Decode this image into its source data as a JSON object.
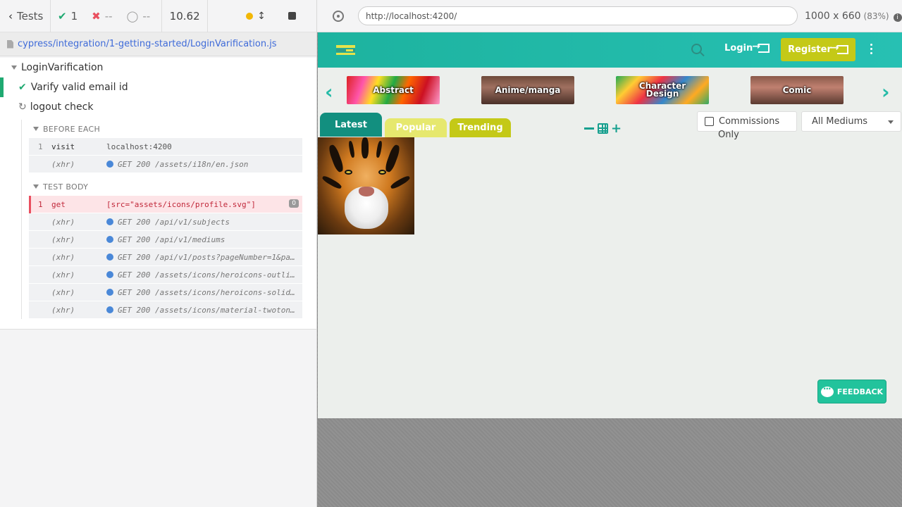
{
  "reporter": {
    "header": {
      "tests_label": "Tests",
      "passed_count": "1",
      "failed_count": "--",
      "pending_count": "--",
      "duration": "10.62"
    },
    "spec_path": "cypress/integration/1-getting-started/LoginVarification.js",
    "suite": {
      "title": "LoginVarification",
      "tests": [
        {
          "title": "Varify valid email id",
          "state": "passed"
        },
        {
          "title": "logout check",
          "state": "running"
        }
      ]
    },
    "before_each": {
      "title": "BEFORE EACH",
      "commands": [
        {
          "index": "1",
          "name": "visit",
          "message": "localhost:4200"
        },
        {
          "index": "",
          "name": "(xhr)",
          "message": "GET 200 /assets/i18n/en.json"
        }
      ]
    },
    "test_body": {
      "title": "TEST BODY",
      "failed_command": {
        "index": "1",
        "name": "get",
        "message": "[src=\"assets/icons/profile.svg\"]",
        "badge": "0"
      },
      "commands": [
        {
          "name": "(xhr)",
          "message": "GET 200 /api/v1/subjects"
        },
        {
          "name": "(xhr)",
          "message": "GET 200 /api/v1/mediums"
        },
        {
          "name": "(xhr)",
          "message": "GET 200 /api/v1/posts?pageNumber=1&pa…"
        },
        {
          "name": "(xhr)",
          "message": "GET 200 /assets/icons/heroicons-outli…"
        },
        {
          "name": "(xhr)",
          "message": "GET 200 /assets/icons/heroicons-solid…"
        },
        {
          "name": "(xhr)",
          "message": "GET 200 /assets/icons/material-twoton…"
        }
      ]
    }
  },
  "browser": {
    "url": "http://localhost:4200/",
    "viewport": "1000 x 660",
    "scale": "(83%)"
  },
  "app": {
    "nav": {
      "login_label": "Login",
      "register_label": "Register"
    },
    "categories": [
      "Abstract",
      "Anime/manga",
      "Character Design",
      "Comic"
    ],
    "tabs": [
      "Latest",
      "Popular",
      "Trending"
    ],
    "filters": {
      "commissions_label": "Commissions",
      "commissions_label_line2": "Only",
      "mediums_selected": "All Mediums"
    },
    "feedback_label": "FEEDBACK",
    "colors": {
      "navbar": "#1fb8a6",
      "register": "#c4c917",
      "latest_tab": "#128f7f",
      "popular_tab": "#e6e86e",
      "trending_tab": "#c4c917"
    }
  }
}
